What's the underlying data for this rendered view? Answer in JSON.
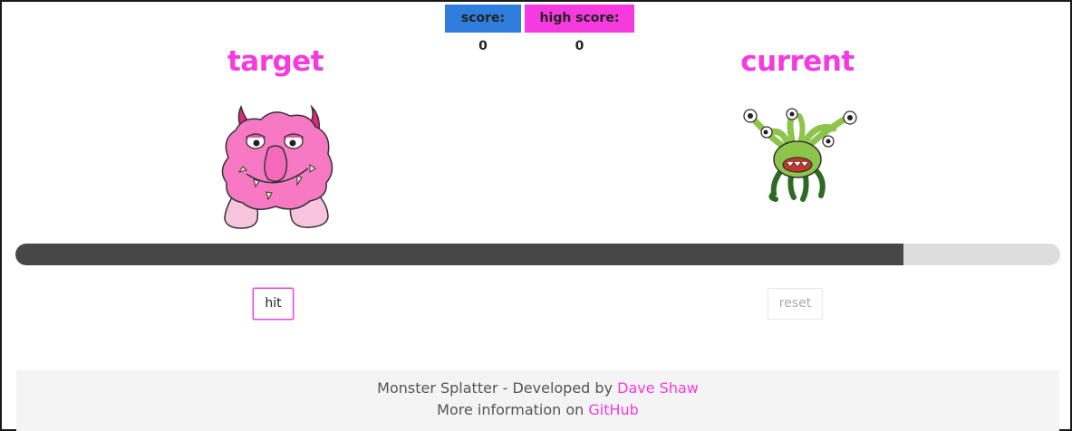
{
  "scoreboard": {
    "score_label": "score: 0",
    "high_score_label": "high score: 0",
    "score_color": "#2f7ddd",
    "high_score_color": "#f53ae0"
  },
  "target": {
    "heading": "target",
    "monster_icon": "pink-furry-horned-monster-icon"
  },
  "current": {
    "heading": "current",
    "monster_icon": "green-tentacle-eyestalk-monster-icon"
  },
  "timer": {
    "progress_fraction": 0.85
  },
  "controls": {
    "hit_label": "hit",
    "reset_label": "reset"
  },
  "footer": {
    "line1_prefix": "Monster Splatter - Developed by ",
    "author_link": "Dave Shaw",
    "line2_prefix": "More information on ",
    "github_link": "GitHub"
  },
  "colors": {
    "accent": "#f53ae0",
    "progress_fill": "#474747",
    "progress_track": "#dddddd"
  }
}
